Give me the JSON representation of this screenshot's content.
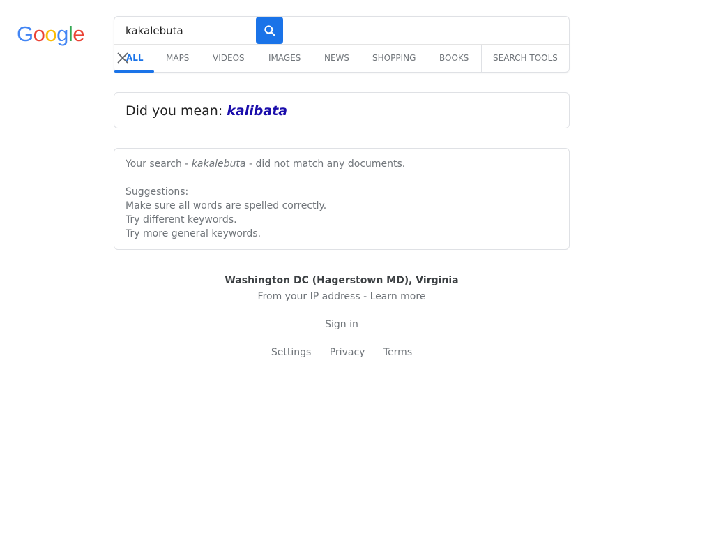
{
  "logo": {
    "letters": [
      {
        "ch": "G",
        "color": "#4285F4"
      },
      {
        "ch": "o",
        "color": "#EA4335"
      },
      {
        "ch": "o",
        "color": "#FBBC05"
      },
      {
        "ch": "g",
        "color": "#4285F4"
      },
      {
        "ch": "l",
        "color": "#34A853"
      },
      {
        "ch": "e",
        "color": "#EA4335"
      }
    ]
  },
  "search": {
    "value": "kakalebuta",
    "button_icon": "search-icon",
    "button_color": "#1a73e8"
  },
  "tabs": [
    {
      "label": "ALL",
      "active": true
    },
    {
      "label": "MAPS"
    },
    {
      "label": "VIDEOS"
    },
    {
      "label": "IMAGES"
    },
    {
      "label": "NEWS"
    },
    {
      "label": "SHOPPING"
    },
    {
      "label": "BOOKS"
    },
    {
      "label": "SEARCH TOOLS"
    }
  ],
  "did_you_mean": {
    "prefix": "Did you mean:",
    "suggestion": "kalibata"
  },
  "no_match": {
    "before": "Your search - ",
    "query": "kakalebuta",
    "after": " - did not match any documents.",
    "suggestions_title": "Suggestions:",
    "suggestions": [
      "Make sure all words are spelled correctly.",
      "Try different keywords.",
      "Try more general keywords."
    ]
  },
  "footer": {
    "location": "Washington DC (Hagerstown MD), Virginia",
    "ip_text": "From your IP address",
    "separator": " - ",
    "learn_more": "Learn more",
    "sign_in": "Sign in",
    "links": [
      "Settings",
      "Privacy",
      "Terms"
    ]
  },
  "colors": {
    "accent": "#1a73e8",
    "link": "#1a0dab",
    "muted": "#70757a"
  }
}
